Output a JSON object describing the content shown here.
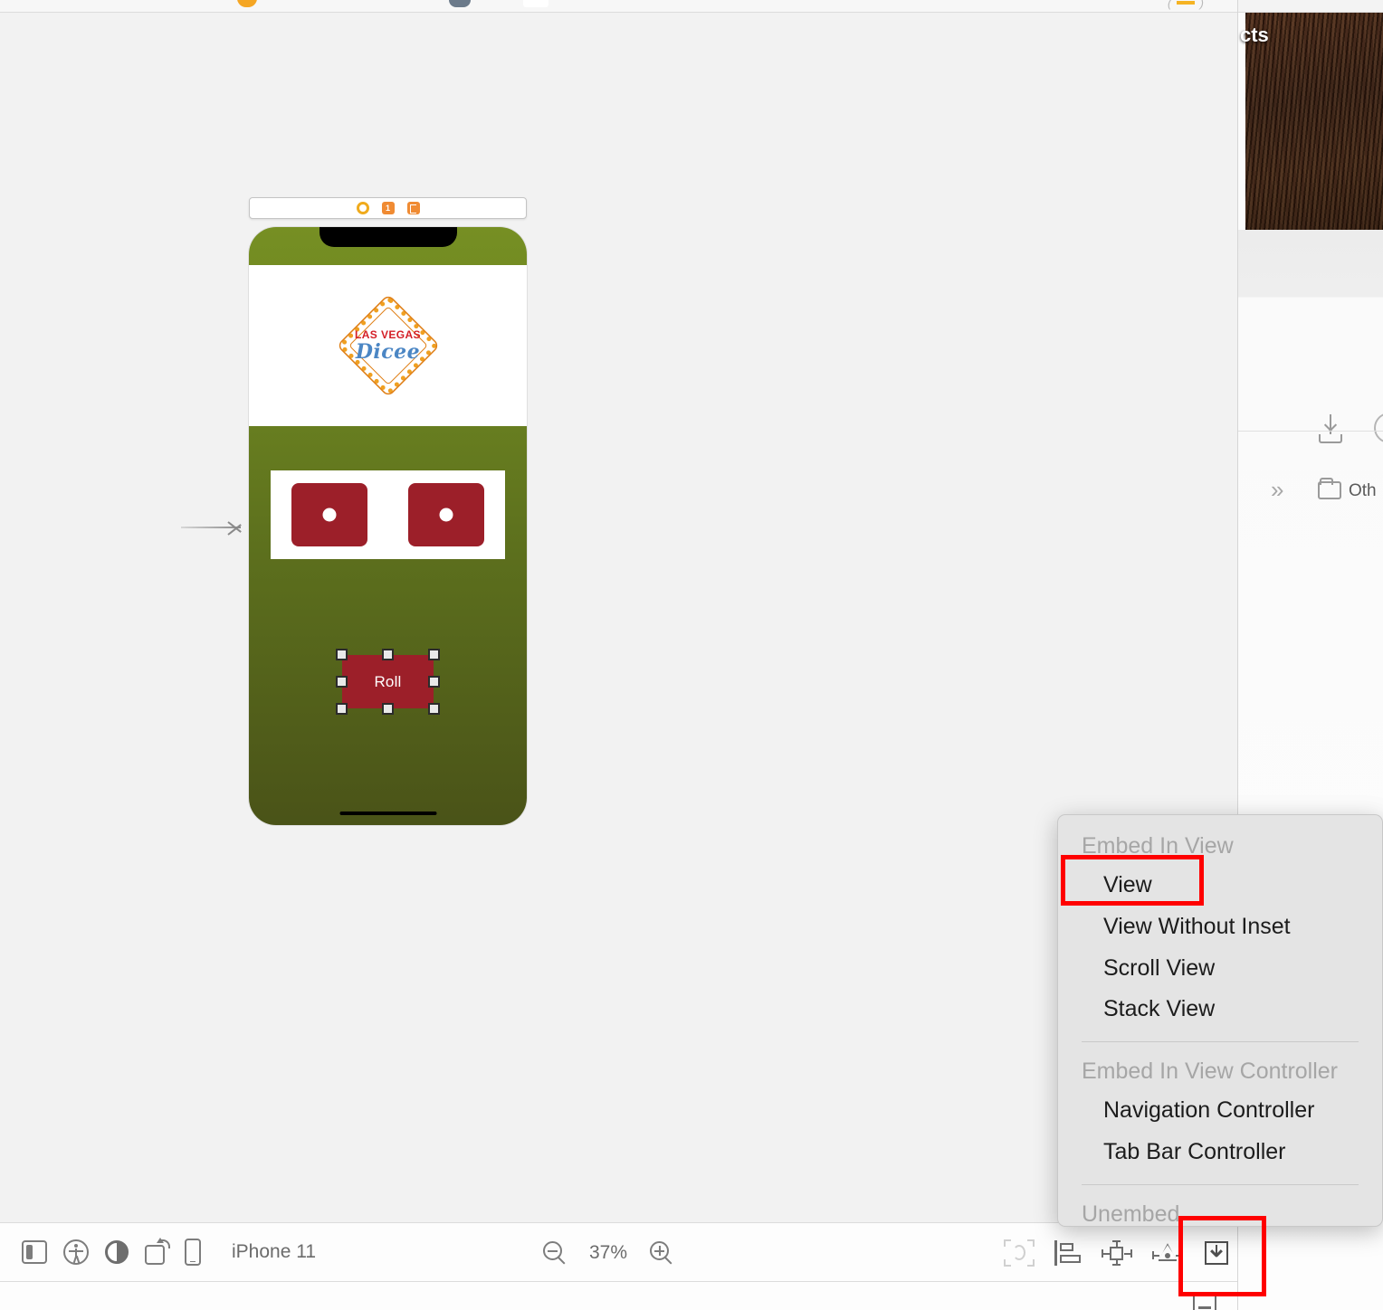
{
  "window": {
    "background_app": {
      "title_fragment": "cts",
      "other_label": "Oth",
      "icons": [
        "download-icon",
        "chevrons-right-icon",
        "folder-icon",
        "circle-icon"
      ]
    }
  },
  "canvas": {
    "scene_dock": {
      "icons": [
        {
          "name": "view-controller-icon",
          "label": ""
        },
        {
          "name": "first-responder-icon",
          "label": "1"
        },
        {
          "name": "exit-icon",
          "label": ""
        }
      ]
    },
    "entry_point_arrow": "storyboard-entry-point",
    "device_preview": {
      "logo": {
        "line1": "LAS VEGAS",
        "line2": "Dicee"
      },
      "dice": [
        {
          "name": "dice-one",
          "value": 1
        },
        {
          "name": "dice-two",
          "value": 1
        }
      ],
      "roll_button": {
        "label": "Roll",
        "selected": true
      },
      "colors": {
        "background_top": "#768f23",
        "background_bottom": "#4a5318",
        "dice_red": "#9c1f29",
        "logo_red": "#d41f26",
        "logo_blue": "#4b86c4",
        "logo_gold": "#f0a021"
      }
    }
  },
  "context_menu": {
    "sections": [
      {
        "header": "Embed In View",
        "items": [
          {
            "label": "View",
            "highlighted": true
          },
          {
            "label": "View Without Inset",
            "highlighted": false
          },
          {
            "label": "Scroll View",
            "highlighted": false
          },
          {
            "label": "Stack View",
            "highlighted": false
          }
        ]
      },
      {
        "header": "Embed In View Controller",
        "items": [
          {
            "label": "Navigation Controller",
            "highlighted": false
          },
          {
            "label": "Tab Bar Controller",
            "highlighted": false
          }
        ]
      },
      {
        "header": "Unembed",
        "items": []
      }
    ]
  },
  "bottom_toolbar": {
    "left_icons": [
      "sidebar-toggle-icon",
      "accessibility-icon",
      "appearance-contrast-icon",
      "rotate-device-icon",
      "device-variant-icon"
    ],
    "device_name": "iPhone 11",
    "zoom_out_icon": "zoom-out-icon",
    "zoom_level": "37%",
    "zoom_in_icon": "zoom-in-icon",
    "right_icons": [
      "resolve-auto-layout-issues-icon",
      "align-icon",
      "add-new-constraints-icon",
      "update-frames-icon",
      "embed-in-icon"
    ]
  },
  "annotations": {
    "accent_red": "#ff0000",
    "highlight_targets": [
      "View",
      "embed-in-icon"
    ]
  }
}
